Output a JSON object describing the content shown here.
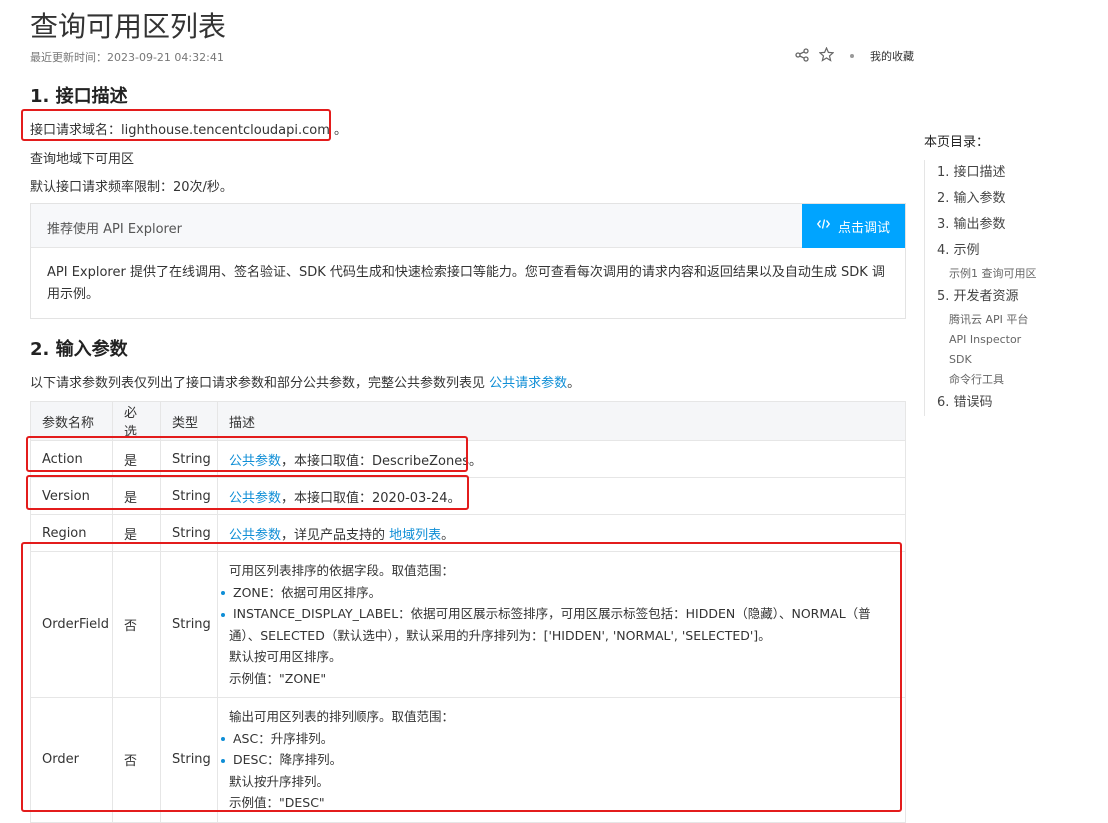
{
  "page": {
    "title": "查询可用区列表",
    "updated_label": "最近更新时间：",
    "updated_value": "2023-09-21 04:32:41",
    "favorites": "我的收藏"
  },
  "section1": {
    "heading": "1. 接口描述",
    "domain_label": "接口请求域名：",
    "domain_value": "lighthouse.tencentcloudapi.com",
    "domain_suffix": " 。",
    "desc": "查询地域下可用区",
    "rate_limit": "默认接口请求频率限制：20次/秒。"
  },
  "explorer": {
    "head": "推荐使用 API Explorer",
    "button": "点击调试",
    "body": "API Explorer 提供了在线调用、签名验证、SDK 代码生成和快速检索接口等能力。您可查看每次调用的请求内容和返回结果以及自动生成 SDK 调用示例。"
  },
  "section2": {
    "heading": "2. 输入参数",
    "intro": "以下请求参数列表仅列出了接口请求参数和部分公共参数，完整公共参数列表见",
    "intro_link": "公共请求参数",
    "intro_end": "。"
  },
  "table": {
    "headers": [
      "参数名称",
      "必选",
      "类型",
      "描述"
    ],
    "rows": [
      {
        "name": "Action",
        "required": "是",
        "type": "String",
        "link": "公共参数",
        "text": "，本接口取值：DescribeZones。"
      },
      {
        "name": "Version",
        "required": "是",
        "type": "String",
        "link": "公共参数",
        "text": "，本接口取值：2020-03-24。"
      },
      {
        "name": "Region",
        "required": "是",
        "type": "String",
        "link": "公共参数",
        "text": "，详见产品支持的 ",
        "link2": "地域列表",
        "text2": "。"
      },
      {
        "name": "OrderField",
        "required": "否",
        "type": "String",
        "lines": [
          "可用区列表排序的依据字段。取值范围：",
          "ZONE：依据可用区排序。",
          "INSTANCE_DISPLAY_LABEL：依据可用区展示标签排序，可用区展示标签包括：HIDDEN（隐藏）、NORMAL（普通）、SELECTED（默认选中），默认采用的升序排列为：['HIDDEN', 'NORMAL', 'SELECTED']。",
          "默认按可用区排序。",
          "示例值：\"ZONE\""
        ]
      },
      {
        "name": "Order",
        "required": "否",
        "type": "String",
        "lines": [
          "输出可用区列表的排列顺序。取值范围：",
          "ASC：升序排列。",
          "DESC：降序排列。",
          "默认按升序排列。",
          "示例值：\"DESC\""
        ]
      }
    ]
  },
  "toc": {
    "title": "本页目录：",
    "items": [
      {
        "label": "1. 接口描述"
      },
      {
        "label": "2. 输入参数"
      },
      {
        "label": "3. 输出参数"
      },
      {
        "label": "4. 示例"
      },
      {
        "label": "示例1 查询可用区",
        "sub": true
      },
      {
        "label": "5. 开发者资源"
      },
      {
        "label": "腾讯云 API 平台",
        "sub": true
      },
      {
        "label": "API Inspector",
        "sub": true
      },
      {
        "label": "SDK",
        "sub": true
      },
      {
        "label": "命令行工具",
        "sub": true
      },
      {
        "label": "6. 错误码"
      }
    ]
  },
  "icons": {
    "share": "share-icon",
    "star": "star-icon",
    "code": "code-icon"
  },
  "colors": {
    "accent": "#00a4ff",
    "link": "#0f8ed6",
    "highlight": "#e31c1c"
  }
}
